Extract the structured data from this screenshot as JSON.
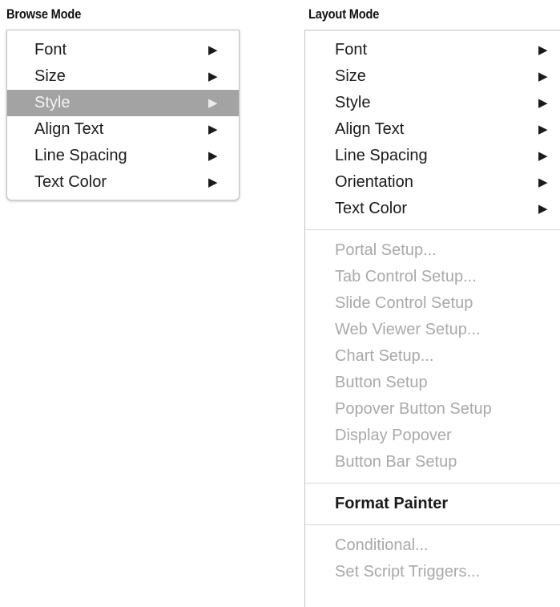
{
  "browse": {
    "title": "Browse Mode",
    "items": [
      {
        "label": "Font",
        "arrow": "▶"
      },
      {
        "label": "Size",
        "arrow": "▶"
      },
      {
        "label": "Style",
        "arrow": "▶"
      },
      {
        "label": "Align Text",
        "arrow": "▶"
      },
      {
        "label": "Line Spacing",
        "arrow": "▶"
      },
      {
        "label": "Text Color",
        "arrow": "▶"
      }
    ],
    "highlighted_item": "Style"
  },
  "layout": {
    "title": "Layout Mode",
    "submenu_items": [
      {
        "label": "Font",
        "arrow": "▶"
      },
      {
        "label": "Size",
        "arrow": "▶"
      },
      {
        "label": "Style",
        "arrow": "▶"
      },
      {
        "label": "Align Text",
        "arrow": "▶"
      },
      {
        "label": "Line Spacing",
        "arrow": "▶"
      },
      {
        "label": "Orientation",
        "arrow": "▶"
      },
      {
        "label": "Text Color",
        "arrow": "▶"
      }
    ],
    "setup_items": [
      "Portal Setup...",
      "Tab Control Setup...",
      "Slide Control Setup",
      "Web Viewer Setup...",
      "Chart Setup...",
      "Button Setup",
      "Popover Button Setup",
      "Display Popover",
      "Button Bar Setup"
    ],
    "format_painter": "Format Painter",
    "trigger_items": [
      "Conditional...",
      "Set Script Triggers..."
    ]
  },
  "colors": {
    "highlight": "#a3a3a3",
    "disabled_text": "#a9a9a9",
    "text": "#1a1a1a"
  }
}
